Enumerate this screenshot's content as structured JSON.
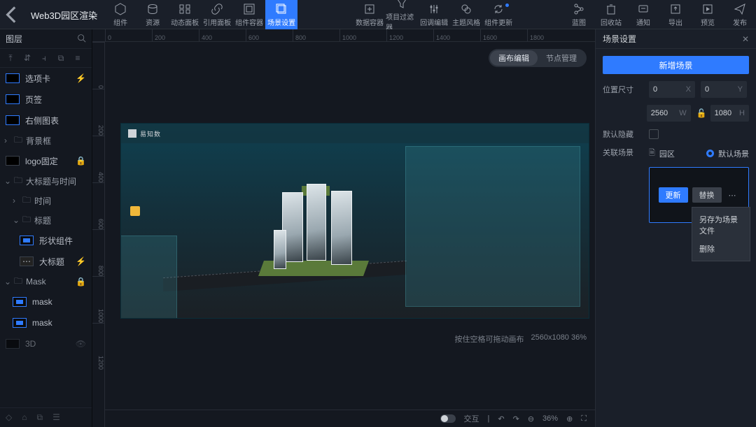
{
  "header": {
    "title": "Web3D园区渲染",
    "tools_left": [
      {
        "id": "component",
        "label": "组件"
      },
      {
        "id": "resource",
        "label": "资源"
      },
      {
        "id": "dynpanel",
        "label": "动态面板"
      },
      {
        "id": "refpanel",
        "label": "引用面板"
      },
      {
        "id": "container",
        "label": "组件容器"
      },
      {
        "id": "scenecfg",
        "label": "场景设置"
      }
    ],
    "tools_mid": [
      {
        "id": "datacontainer",
        "label": "数据容器"
      },
      {
        "id": "filter",
        "label": "项目过滤器"
      },
      {
        "id": "callback",
        "label": "回调编辑"
      },
      {
        "id": "theme",
        "label": "主题风格"
      },
      {
        "id": "compupd",
        "label": "组件更新"
      }
    ],
    "tools_right": [
      {
        "id": "blueprint",
        "label": "蓝图"
      },
      {
        "id": "recycle",
        "label": "回收站"
      },
      {
        "id": "notify",
        "label": "通知"
      },
      {
        "id": "export",
        "label": "导出"
      },
      {
        "id": "preview",
        "label": "预览"
      },
      {
        "id": "publish",
        "label": "发布"
      }
    ]
  },
  "sidebar": {
    "title": "图层",
    "items": [
      {
        "label": "选项卡",
        "type": "row",
        "bolt": true,
        "thumb": "a"
      },
      {
        "label": "页签",
        "type": "row",
        "thumb": "a"
      },
      {
        "label": "右侧图表",
        "type": "row",
        "thumb": "a"
      },
      {
        "label": "背景框",
        "type": "group",
        "chev": "›"
      },
      {
        "label": "logo固定",
        "type": "row",
        "lock": true,
        "thumb": "plain",
        "indent": 0
      },
      {
        "label": "大标题与时间",
        "type": "group",
        "chev": "⌄"
      },
      {
        "label": "时间",
        "type": "group",
        "chev": "›",
        "indent": 1
      },
      {
        "label": "标题",
        "type": "group",
        "chev": "⌄",
        "indent": 1
      },
      {
        "label": "形状组件",
        "type": "row",
        "thumb": "dot",
        "indent": 2
      },
      {
        "label": "大标题",
        "type": "row",
        "bolt": true,
        "thumb": "txt",
        "indent": 2
      },
      {
        "label": "Mask",
        "type": "group",
        "chev": "⌄",
        "lock": true
      },
      {
        "label": "mask",
        "type": "row",
        "thumb": "dot",
        "indent": 1
      },
      {
        "label": "mask",
        "type": "row",
        "thumb": "dot",
        "indent": 1
      },
      {
        "label": "3D",
        "type": "row",
        "dim": true,
        "thumb": "plain",
        "eye": true
      }
    ]
  },
  "canvas": {
    "mode_edit": "画布编辑",
    "mode_nodes": "节点管理",
    "hint_drag": "按住空格可拖动画布",
    "hint_size": "2560x1080 36%",
    "ticks_h": [
      "0",
      "200",
      "400",
      "600",
      "800",
      "1000",
      "1200",
      "1400",
      "1600",
      "1800"
    ],
    "ticks_v": [
      "0",
      "200",
      "400",
      "600",
      "800",
      "1000",
      "1200"
    ],
    "brand": "易知数",
    "bottom_interact": "交互",
    "bottom_zoom": "36%"
  },
  "inspector": {
    "title": "场景设置",
    "add_scene": "新增场景",
    "pos_label": "位置尺寸",
    "x": "0",
    "y": "0",
    "w": "2560",
    "h": "1080",
    "hide_label": "默认隐藏",
    "link_label": "关联场景",
    "link_name": "园区",
    "default_scene": "默认场景",
    "update": "更新",
    "replace": "替换",
    "dd_saveas": "另存为场景文件",
    "dd_delete": "删除"
  }
}
